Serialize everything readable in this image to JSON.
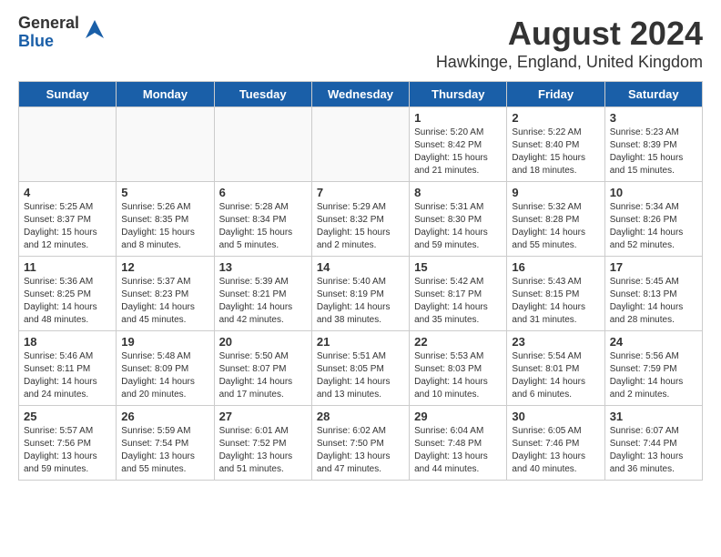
{
  "header": {
    "logo_line1": "General",
    "logo_line2": "Blue",
    "title": "August 2024",
    "subtitle": "Hawkinge, England, United Kingdom"
  },
  "calendar": {
    "headers": [
      "Sunday",
      "Monday",
      "Tuesday",
      "Wednesday",
      "Thursday",
      "Friday",
      "Saturday"
    ],
    "weeks": [
      [
        {
          "day": "",
          "info": ""
        },
        {
          "day": "",
          "info": ""
        },
        {
          "day": "",
          "info": ""
        },
        {
          "day": "",
          "info": ""
        },
        {
          "day": "1",
          "info": "Sunrise: 5:20 AM\nSunset: 8:42 PM\nDaylight: 15 hours\nand 21 minutes."
        },
        {
          "day": "2",
          "info": "Sunrise: 5:22 AM\nSunset: 8:40 PM\nDaylight: 15 hours\nand 18 minutes."
        },
        {
          "day": "3",
          "info": "Sunrise: 5:23 AM\nSunset: 8:39 PM\nDaylight: 15 hours\nand 15 minutes."
        }
      ],
      [
        {
          "day": "4",
          "info": "Sunrise: 5:25 AM\nSunset: 8:37 PM\nDaylight: 15 hours\nand 12 minutes."
        },
        {
          "day": "5",
          "info": "Sunrise: 5:26 AM\nSunset: 8:35 PM\nDaylight: 15 hours\nand 8 minutes."
        },
        {
          "day": "6",
          "info": "Sunrise: 5:28 AM\nSunset: 8:34 PM\nDaylight: 15 hours\nand 5 minutes."
        },
        {
          "day": "7",
          "info": "Sunrise: 5:29 AM\nSunset: 8:32 PM\nDaylight: 15 hours\nand 2 minutes."
        },
        {
          "day": "8",
          "info": "Sunrise: 5:31 AM\nSunset: 8:30 PM\nDaylight: 14 hours\nand 59 minutes."
        },
        {
          "day": "9",
          "info": "Sunrise: 5:32 AM\nSunset: 8:28 PM\nDaylight: 14 hours\nand 55 minutes."
        },
        {
          "day": "10",
          "info": "Sunrise: 5:34 AM\nSunset: 8:26 PM\nDaylight: 14 hours\nand 52 minutes."
        }
      ],
      [
        {
          "day": "11",
          "info": "Sunrise: 5:36 AM\nSunset: 8:25 PM\nDaylight: 14 hours\nand 48 minutes."
        },
        {
          "day": "12",
          "info": "Sunrise: 5:37 AM\nSunset: 8:23 PM\nDaylight: 14 hours\nand 45 minutes."
        },
        {
          "day": "13",
          "info": "Sunrise: 5:39 AM\nSunset: 8:21 PM\nDaylight: 14 hours\nand 42 minutes."
        },
        {
          "day": "14",
          "info": "Sunrise: 5:40 AM\nSunset: 8:19 PM\nDaylight: 14 hours\nand 38 minutes."
        },
        {
          "day": "15",
          "info": "Sunrise: 5:42 AM\nSunset: 8:17 PM\nDaylight: 14 hours\nand 35 minutes."
        },
        {
          "day": "16",
          "info": "Sunrise: 5:43 AM\nSunset: 8:15 PM\nDaylight: 14 hours\nand 31 minutes."
        },
        {
          "day": "17",
          "info": "Sunrise: 5:45 AM\nSunset: 8:13 PM\nDaylight: 14 hours\nand 28 minutes."
        }
      ],
      [
        {
          "day": "18",
          "info": "Sunrise: 5:46 AM\nSunset: 8:11 PM\nDaylight: 14 hours\nand 24 minutes."
        },
        {
          "day": "19",
          "info": "Sunrise: 5:48 AM\nSunset: 8:09 PM\nDaylight: 14 hours\nand 20 minutes."
        },
        {
          "day": "20",
          "info": "Sunrise: 5:50 AM\nSunset: 8:07 PM\nDaylight: 14 hours\nand 17 minutes."
        },
        {
          "day": "21",
          "info": "Sunrise: 5:51 AM\nSunset: 8:05 PM\nDaylight: 14 hours\nand 13 minutes."
        },
        {
          "day": "22",
          "info": "Sunrise: 5:53 AM\nSunset: 8:03 PM\nDaylight: 14 hours\nand 10 minutes."
        },
        {
          "day": "23",
          "info": "Sunrise: 5:54 AM\nSunset: 8:01 PM\nDaylight: 14 hours\nand 6 minutes."
        },
        {
          "day": "24",
          "info": "Sunrise: 5:56 AM\nSunset: 7:59 PM\nDaylight: 14 hours\nand 2 minutes."
        }
      ],
      [
        {
          "day": "25",
          "info": "Sunrise: 5:57 AM\nSunset: 7:56 PM\nDaylight: 13 hours\nand 59 minutes."
        },
        {
          "day": "26",
          "info": "Sunrise: 5:59 AM\nSunset: 7:54 PM\nDaylight: 13 hours\nand 55 minutes."
        },
        {
          "day": "27",
          "info": "Sunrise: 6:01 AM\nSunset: 7:52 PM\nDaylight: 13 hours\nand 51 minutes."
        },
        {
          "day": "28",
          "info": "Sunrise: 6:02 AM\nSunset: 7:50 PM\nDaylight: 13 hours\nand 47 minutes."
        },
        {
          "day": "29",
          "info": "Sunrise: 6:04 AM\nSunset: 7:48 PM\nDaylight: 13 hours\nand 44 minutes."
        },
        {
          "day": "30",
          "info": "Sunrise: 6:05 AM\nSunset: 7:46 PM\nDaylight: 13 hours\nand 40 minutes."
        },
        {
          "day": "31",
          "info": "Sunrise: 6:07 AM\nSunset: 7:44 PM\nDaylight: 13 hours\nand 36 minutes."
        }
      ]
    ]
  }
}
